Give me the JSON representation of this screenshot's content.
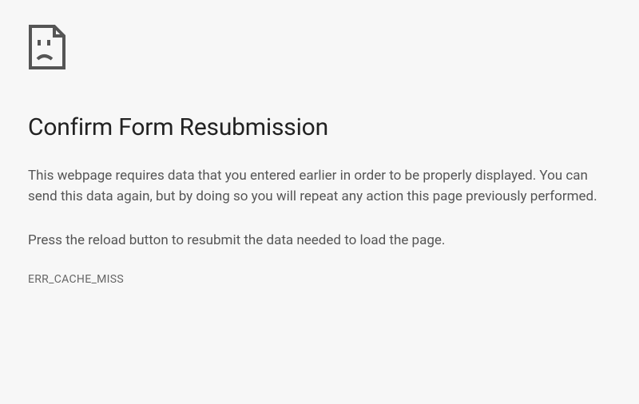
{
  "error": {
    "title": "Confirm Form Resubmission",
    "paragraph1": "This webpage requires data that you entered earlier in order to be properly displayed. You can send this data again, but by doing so you will repeat any action this page previously performed.",
    "paragraph2": "Press the reload button to resubmit the data needed to load the page.",
    "code": "ERR_CACHE_MISS"
  }
}
